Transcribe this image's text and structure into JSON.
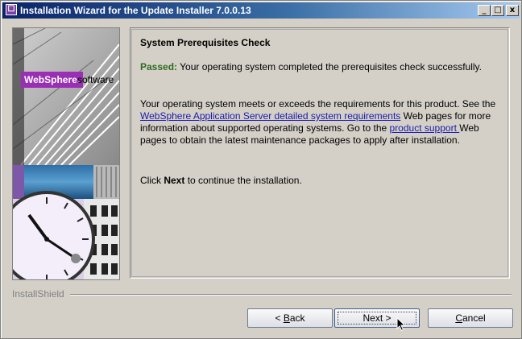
{
  "window": {
    "title": "Installation Wizard for the Update Installer 7.0.0.13",
    "icon": "purple-app-icon",
    "controls": {
      "minimize": "_",
      "maximize": "□",
      "close": "x"
    }
  },
  "sidebar": {
    "brand": "WebSphere.",
    "brand_suffix": "software",
    "brand_color": "#9a2fb5"
  },
  "content": {
    "heading": "System Prerequisites Check",
    "passed_label": "Passed:",
    "passed_text": " Your operating system completed the prerequisites check successfully.",
    "para2_a": "Your operating system meets or exceeds the requirements for this product. See the ",
    "link1": "WebSphere Application Server detailed system requirements",
    "para2_b": " Web pages for more information about supported operating systems. Go to the ",
    "link2": "product support ",
    "para2_c": "Web pages to obtain the latest maintenance packages to apply after installation.",
    "para3_a": "Click ",
    "para3_bold": "Next",
    "para3_b": " to continue the installation."
  },
  "footer": {
    "brand": "InstallShield",
    "back_prefix": "< ",
    "back_mnemonic": "B",
    "back_rest": "ack",
    "next_label": "Next >",
    "cancel_mnemonic": "C",
    "cancel_rest": "ancel"
  }
}
